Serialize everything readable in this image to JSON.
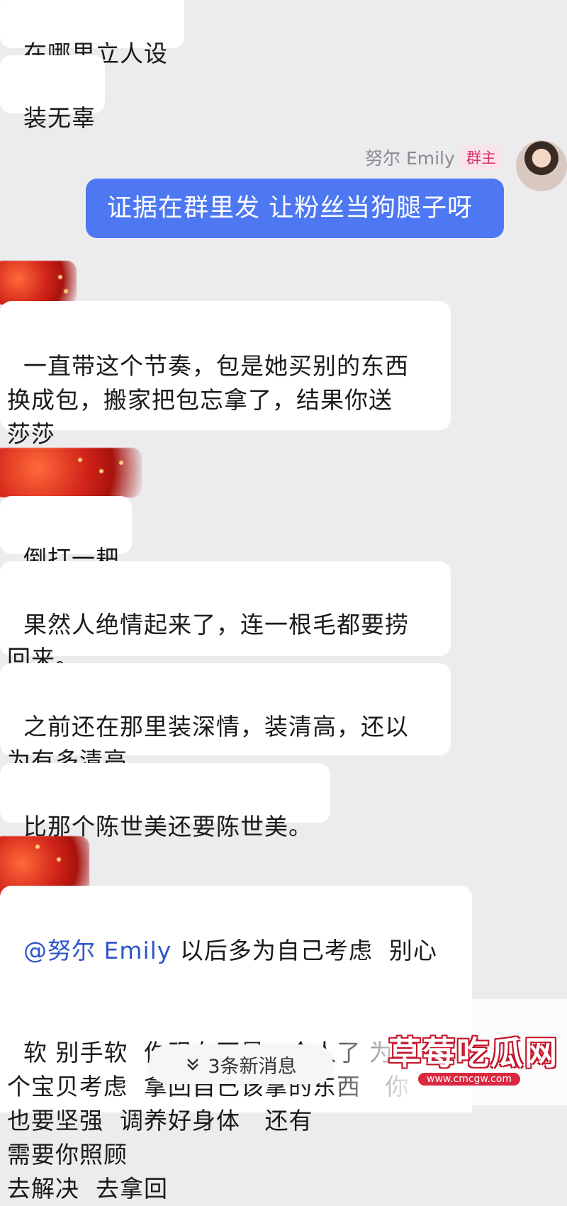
{
  "messages": {
    "m1": "在哪里立人设",
    "m2": "装无辜",
    "self": {
      "sender_name": "努尔 Emily",
      "role": "群主",
      "text": "证据在群里发 让粉丝当狗腿子呀"
    },
    "m3": "一直带这个节奏，包是她买别的东西\n换成包，搬家把包忘拿了，结果你送\n莎莎",
    "m4": "倒打一耙",
    "m5": "果然人绝情起来了，连一根毛都要捞\n回来。",
    "m6": "之前还在那里装深情，装清高，还以\n为有多清高。",
    "m7": "比那个陈世美还要陈世美。",
    "m8": {
      "mention": "@努尔 Emily",
      "text_line1": " 以后多为自己考虑  别心",
      "text_rest": "软 别手软  你现在不是一个人了 为两\n个宝贝考虑  拿回自己该拿的东西   你\n也要坚强  调养好身体   还有\n需要你照顾\n去解决  去拿回"
    }
  },
  "new_messages_button": {
    "icon": "double-chevron-down-icon",
    "label": "3条新消息"
  },
  "watermark": {
    "title": "草莓吃瓜网",
    "url": "www.cmcgw.com"
  },
  "colors": {
    "self_bubble": "#4d78f2",
    "background": "#ececef",
    "badge_text": "#d6306a",
    "mention": "#2d56c9"
  }
}
